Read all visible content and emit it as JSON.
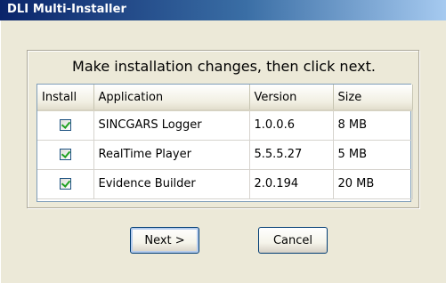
{
  "window": {
    "title": "DLI Multi-Installer"
  },
  "instruction": "Make installation changes, then click next.",
  "table": {
    "columns": [
      "Install",
      "Application",
      "Version",
      "Size"
    ],
    "rows": [
      {
        "install": true,
        "application": "SINCGARS Logger",
        "version": "1.0.0.6",
        "size": "8 MB"
      },
      {
        "install": true,
        "application": "RealTime Player",
        "version": "5.5.5.27",
        "size": "5 MB"
      },
      {
        "install": true,
        "application": "Evidence Builder",
        "version": "2.0.194",
        "size": "20 MB"
      }
    ]
  },
  "buttons": {
    "next": "Next >",
    "cancel": "Cancel"
  },
  "colors": {
    "title_bar": "#0A246A",
    "check": "#21A121",
    "dialog_bg": "#ECE9D8"
  }
}
